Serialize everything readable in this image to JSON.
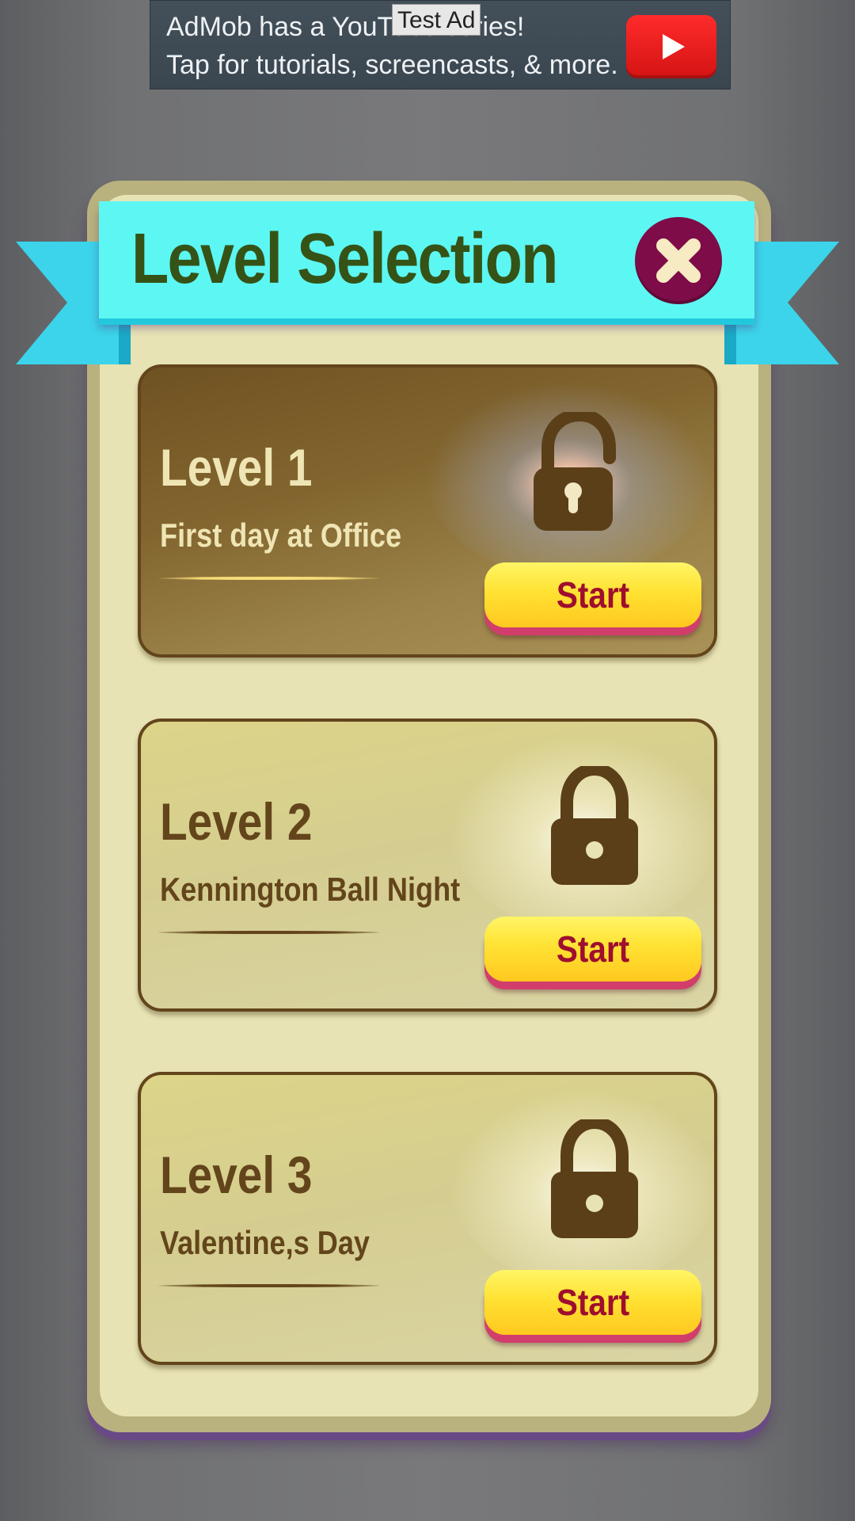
{
  "ad": {
    "line1": "AdMob has a YouTube series!",
    "line2": "Tap for tutorials, screencasts, & more.",
    "test_label": "Test Ad",
    "play_icon": "youtube-play-icon"
  },
  "dialog": {
    "title": "Level Selection",
    "close_icon": "close-x-icon"
  },
  "levels": [
    {
      "title": "Level 1",
      "subtitle": "First day at Office",
      "state": "unlocked",
      "lock_icon": "unlocked-padlock-icon",
      "button_label": "Start"
    },
    {
      "title": "Level 2",
      "subtitle": "Kennington Ball Night",
      "state": "locked",
      "lock_icon": "padlock-icon",
      "button_label": "Start"
    },
    {
      "title": "Level 3",
      "subtitle": "Valentine,s Day",
      "state": "locked",
      "lock_icon": "padlock-icon",
      "button_label": "Start"
    }
  ],
  "colors": {
    "ribbon": "#5cf7f3",
    "title_text": "#365317",
    "close_button": "#7e0c48",
    "panel": "#e7e3b4",
    "card_border": "#63451b",
    "start_button": "#ffe233",
    "start_text": "#9e0e2e"
  }
}
